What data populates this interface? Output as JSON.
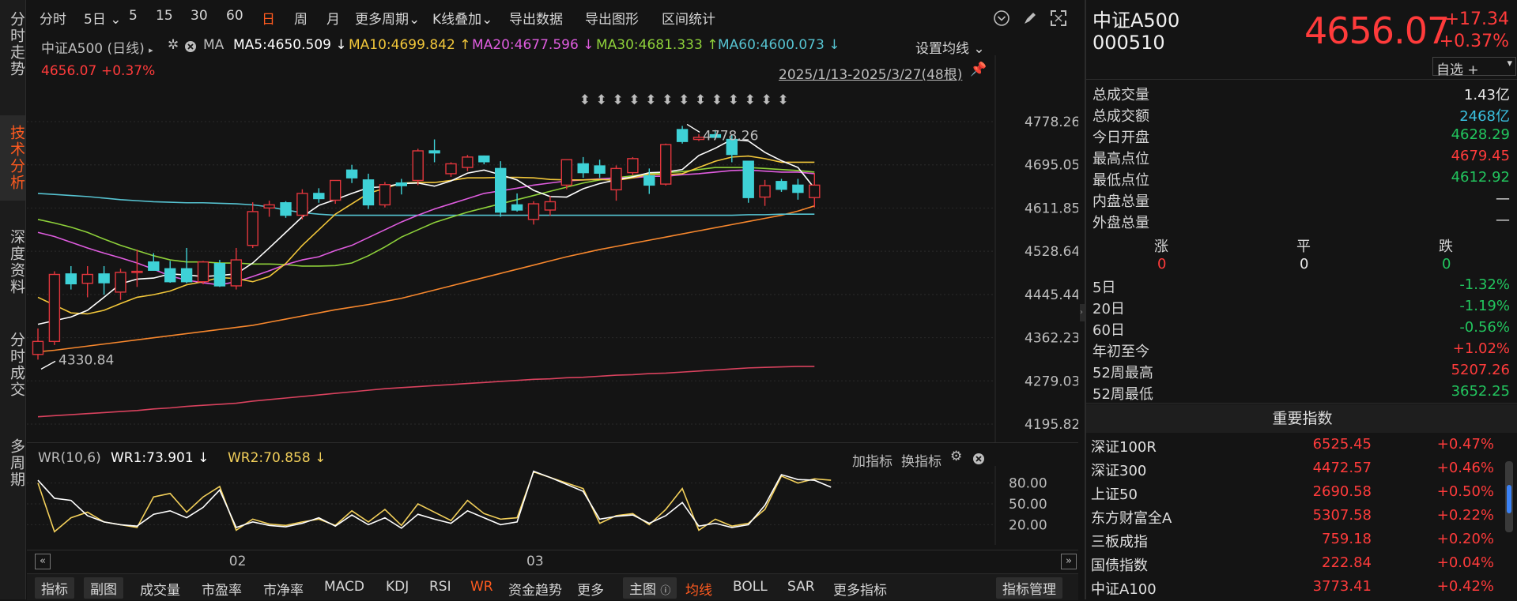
{
  "left_nav": [
    {
      "label": "分时走势",
      "active": false
    },
    {
      "label": "技术分析",
      "active": true
    },
    {
      "label": "深度资料",
      "active": false
    },
    {
      "label": "分时成交",
      "active": false
    },
    {
      "label": "多周期",
      "active": false
    }
  ],
  "toolbar": {
    "items": [
      "分时",
      "5日",
      "5",
      "15",
      "30",
      "60",
      "日",
      "周",
      "月",
      "更多周期",
      "K线叠加",
      "导出数据",
      "导出图形",
      "区间统计"
    ],
    "active": "日"
  },
  "legend": {
    "index_name": "中证A500 (日线)",
    "ma_label": "MA",
    "ma5": "MA5:4650.509",
    "ma10": "MA10:4699.842",
    "ma20": "MA20:4677.596",
    "ma30": "MA30:4681.333",
    "ma60": "MA60:4600.073",
    "settings": "设置均线",
    "price": "4656.07",
    "pct": "+0.37%",
    "range": "2025/1/13-2025/3/27(48根)"
  },
  "colors": {
    "up": "#e2363d",
    "down": "#3ed1d6",
    "ma5": "#ffffff",
    "ma10": "#f2c73a",
    "ma20": "#df5cdf",
    "ma30": "#8ed13a",
    "ma60": "#56c3d1",
    "ma120": "#f7872d",
    "ma250": "#d9425e",
    "wr1": "#ffffff",
    "wr2": "#f2cf5a"
  },
  "chart_data": {
    "type": "candlestick",
    "y_ticks": [
      "4778.26",
      "4695.05",
      "4611.85",
      "4528.64",
      "4445.44",
      "4362.23",
      "4279.03",
      "4195.82"
    ],
    "ylim": [
      4195.82,
      4778.26
    ],
    "x_ticks": [
      {
        "label": "02",
        "index": 12
      },
      {
        "label": "03",
        "index": 30
      }
    ],
    "annotations": {
      "low": "4330.84",
      "high": "4778.26"
    },
    "candles": [
      {
        "o": 4330,
        "h": 4380,
        "l": 4320,
        "c": 4355
      },
      {
        "o": 4355,
        "h": 4490,
        "l": 4348,
        "c": 4484
      },
      {
        "o": 4485,
        "h": 4500,
        "l": 4455,
        "c": 4466
      },
      {
        "o": 4467,
        "h": 4500,
        "l": 4440,
        "c": 4484
      },
      {
        "o": 4485,
        "h": 4500,
        "l": 4445,
        "c": 4468
      },
      {
        "o": 4450,
        "h": 4495,
        "l": 4435,
        "c": 4488
      },
      {
        "o": 4488,
        "h": 4532,
        "l": 4460,
        "c": 4490
      },
      {
        "o": 4508,
        "h": 4525,
        "l": 4496,
        "c": 4492
      },
      {
        "o": 4495,
        "h": 4510,
        "l": 4468,
        "c": 4470
      },
      {
        "o": 4495,
        "h": 4535,
        "l": 4467,
        "c": 4470
      },
      {
        "o": 4470,
        "h": 4510,
        "l": 4465,
        "c": 4508
      },
      {
        "o": 4505,
        "h": 4512,
        "l": 4460,
        "c": 4462
      },
      {
        "o": 4462,
        "h": 4535,
        "l": 4455,
        "c": 4512
      },
      {
        "o": 4540,
        "h": 4623,
        "l": 4535,
        "c": 4605
      },
      {
        "o": 4612,
        "h": 4626,
        "l": 4595,
        "c": 4618
      },
      {
        "o": 4622,
        "h": 4625,
        "l": 4593,
        "c": 4598
      },
      {
        "o": 4598,
        "h": 4648,
        "l": 4590,
        "c": 4640
      },
      {
        "o": 4640,
        "h": 4650,
        "l": 4622,
        "c": 4630
      },
      {
        "o": 4627,
        "h": 4665,
        "l": 4620,
        "c": 4665
      },
      {
        "o": 4685,
        "h": 4695,
        "l": 4660,
        "c": 4670
      },
      {
        "o": 4666,
        "h": 4678,
        "l": 4610,
        "c": 4618
      },
      {
        "o": 4618,
        "h": 4662,
        "l": 4613,
        "c": 4657
      },
      {
        "o": 4660,
        "h": 4668,
        "l": 4638,
        "c": 4655
      },
      {
        "o": 4665,
        "h": 4726,
        "l": 4656,
        "c": 4722
      },
      {
        "o": 4722,
        "h": 4744,
        "l": 4700,
        "c": 4718
      },
      {
        "o": 4678,
        "h": 4700,
        "l": 4672,
        "c": 4697
      },
      {
        "o": 4690,
        "h": 4714,
        "l": 4683,
        "c": 4710
      },
      {
        "o": 4712,
        "h": 4713,
        "l": 4696,
        "c": 4701
      },
      {
        "o": 4688,
        "h": 4702,
        "l": 4595,
        "c": 4604
      },
      {
        "o": 4618,
        "h": 4640,
        "l": 4605,
        "c": 4608
      },
      {
        "o": 4590,
        "h": 4625,
        "l": 4580,
        "c": 4620
      },
      {
        "o": 4608,
        "h": 4635,
        "l": 4597,
        "c": 4624
      },
      {
        "o": 4656,
        "h": 4706,
        "l": 4648,
        "c": 4705
      },
      {
        "o": 4697,
        "h": 4710,
        "l": 4670,
        "c": 4680
      },
      {
        "o": 4693,
        "h": 4705,
        "l": 4670,
        "c": 4679
      },
      {
        "o": 4647,
        "h": 4694,
        "l": 4626,
        "c": 4688
      },
      {
        "o": 4680,
        "h": 4710,
        "l": 4675,
        "c": 4707
      },
      {
        "o": 4674,
        "h": 4688,
        "l": 4639,
        "c": 4656
      },
      {
        "o": 4658,
        "h": 4736,
        "l": 4655,
        "c": 4734
      },
      {
        "o": 4763,
        "h": 4770,
        "l": 4736,
        "c": 4740
      },
      {
        "o": 4744,
        "h": 4754,
        "l": 4741,
        "c": 4748
      },
      {
        "o": 4753,
        "h": 4762,
        "l": 4744,
        "c": 4748
      },
      {
        "o": 4744,
        "h": 4752,
        "l": 4700,
        "c": 4715
      },
      {
        "o": 4702,
        "h": 4702,
        "l": 4622,
        "c": 4632
      },
      {
        "o": 4633,
        "h": 4666,
        "l": 4616,
        "c": 4655
      },
      {
        "o": 4663,
        "h": 4668,
        "l": 4643,
        "c": 4648
      },
      {
        "o": 4656,
        "h": 4668,
        "l": 4628,
        "c": 4642
      },
      {
        "o": 4632,
        "h": 4679,
        "l": 4613,
        "c": 4656
      }
    ],
    "ma_lines": {
      "ma5": [
        4388,
        4395,
        4402,
        4415,
        4440,
        4466,
        4475,
        4477,
        4485,
        4483,
        4480,
        4482,
        4485,
        4506,
        4535,
        4565,
        4595,
        4617,
        4628,
        4640,
        4651,
        4653,
        4659,
        4660,
        4654,
        4664,
        4679,
        4685,
        4676,
        4666,
        4646,
        4634,
        4633,
        4649,
        4659,
        4666,
        4672,
        4680,
        4681,
        4686,
        4713,
        4727,
        4744,
        4741,
        4719,
        4703,
        4690,
        4650
      ],
      "ma10": [
        4440,
        4425,
        4410,
        4408,
        4415,
        4428,
        4440,
        4445,
        4452,
        4464,
        4470,
        4478,
        4476,
        4470,
        4480,
        4505,
        4540,
        4570,
        4600,
        4620,
        4640,
        4650,
        4660,
        4661,
        4661,
        4665,
        4670,
        4670,
        4671,
        4671,
        4670,
        4667,
        4666,
        4666,
        4667,
        4665,
        4670,
        4677,
        4676,
        4678,
        4690,
        4702,
        4710,
        4712,
        4707,
        4700,
        4700,
        4700
      ],
      "ma20": [
        4565,
        4557,
        4546,
        4535,
        4525,
        4516,
        4506,
        4494,
        4481,
        4473,
        4468,
        4464,
        4470,
        4480,
        4491,
        4503,
        4512,
        4518,
        4530,
        4540,
        4555,
        4570,
        4585,
        4598,
        4610,
        4620,
        4630,
        4640,
        4645,
        4650,
        4656,
        4660,
        4664,
        4666,
        4668,
        4670,
        4670,
        4673,
        4673,
        4676,
        4678,
        4681,
        4684,
        4685,
        4683,
        4681,
        4681,
        4678
      ],
      "ma30": [
        4590,
        4583,
        4575,
        4565,
        4552,
        4540,
        4530,
        4520,
        4512,
        4508,
        4508,
        4506,
        4506,
        4504,
        4504,
        4503,
        4500,
        4500,
        4501,
        4506,
        4520,
        4537,
        4556,
        4570,
        4584,
        4594,
        4604,
        4612,
        4620,
        4628,
        4636,
        4644,
        4652,
        4660,
        4666,
        4670,
        4674,
        4678,
        4680,
        4682,
        4686,
        4690,
        4690,
        4690,
        4688,
        4686,
        4684,
        4681
      ],
      "ma60": [
        4640,
        4638,
        4636,
        4634,
        4631,
        4628,
        4626,
        4624,
        4623,
        4622,
        4622,
        4621,
        4620,
        4618,
        4614,
        4608,
        4603,
        4600,
        4598,
        4598,
        4598,
        4598,
        4598,
        4598,
        4598,
        4598,
        4598,
        4598,
        4598,
        4598,
        4598,
        4598,
        4598,
        4598,
        4598,
        4598,
        4598,
        4598,
        4598,
        4598,
        4598,
        4598,
        4598,
        4599,
        4599,
        4600,
        4600,
        4600
      ],
      "ma120": [
        4335,
        4338,
        4342,
        4346,
        4350,
        4354,
        4358,
        4362,
        4366,
        4370,
        4374,
        4378,
        4382,
        4386,
        4392,
        4398,
        4404,
        4410,
        4416,
        4421,
        4426,
        4432,
        4438,
        4446,
        4454,
        4462,
        4470,
        4478,
        4486,
        4494,
        4502,
        4510,
        4518,
        4525,
        4532,
        4538,
        4544,
        4550,
        4556,
        4562,
        4568,
        4574,
        4580,
        4586,
        4592,
        4598,
        4606,
        4616
      ],
      "ma250": [
        4210,
        4212,
        4214,
        4216,
        4218,
        4220,
        4222,
        4225,
        4227,
        4230,
        4232,
        4234,
        4236,
        4240,
        4243,
        4246,
        4249,
        4252,
        4255,
        4258,
        4261,
        4264,
        4266,
        4268,
        4270,
        4272,
        4274,
        4276,
        4278,
        4280,
        4282,
        4283,
        4285,
        4286,
        4288,
        4290,
        4291,
        4293,
        4294,
        4296,
        4298,
        4300,
        4302,
        4304,
        4305,
        4306,
        4307,
        4307
      ]
    },
    "wr": {
      "label": "WR(10,6)",
      "wr1_label": "WR1:73.901",
      "wr2_label": "WR2:70.858",
      "ylim": [
        0,
        100
      ],
      "y_ticks": [
        "80.00",
        "50.00",
        "20.00"
      ],
      "wr1": [
        84,
        58,
        55,
        33,
        24,
        20,
        18,
        35,
        40,
        30,
        45,
        70,
        16,
        24,
        19,
        17,
        22,
        30,
        18,
        34,
        20,
        30,
        15,
        35,
        28,
        22,
        40,
        30,
        20,
        24,
        97,
        88,
        78,
        68,
        28,
        32,
        34,
        22,
        33,
        52,
        18,
        22,
        16,
        20,
        48,
        92,
        85,
        84,
        74
      ],
      "wr2": [
        80,
        10,
        30,
        38,
        24,
        20,
        16,
        60,
        65,
        38,
        60,
        75,
        12,
        28,
        21,
        19,
        24,
        28,
        19,
        40,
        24,
        42,
        19,
        50,
        38,
        26,
        55,
        36,
        28,
        30,
        96,
        88,
        80,
        72,
        22,
        33,
        36,
        20,
        42,
        72,
        12,
        28,
        18,
        22,
        42,
        90,
        80,
        86,
        84
      ]
    }
  },
  "wr_panel": {
    "add_indicator": "加指标",
    "switch_indicator": "换指标"
  },
  "bottombar": {
    "items": [
      "指标",
      "副图",
      "成交量",
      "市盈率",
      "市净率",
      "MACD",
      "KDJ",
      "RSI",
      "WR",
      "资金趋势",
      "更多",
      "主图",
      "均线",
      "BOLL",
      "SAR",
      "更多指标",
      "指标管理"
    ],
    "active": [
      "WR",
      "均线"
    ]
  },
  "quote": {
    "name": "中证A500",
    "code": "000510",
    "price": "4656.07",
    "change": "+17.34",
    "pct": "+0.37%",
    "watch": "自选 +"
  },
  "stats": [
    {
      "k": "总成交量",
      "v": "1.43亿",
      "c": "white"
    },
    {
      "k": "总成交额",
      "v": "2468亿",
      "c": "cyan"
    },
    {
      "k": "今日开盘",
      "v": "4628.29",
      "c": "green"
    },
    {
      "k": "最高点位",
      "v": "4679.45",
      "c": "red"
    },
    {
      "k": "最低点位",
      "v": "4612.92",
      "c": "green"
    },
    {
      "k": "内盘总量",
      "v": "—",
      "c": "white"
    },
    {
      "k": "外盘总量",
      "v": "—",
      "c": "white"
    }
  ],
  "breadth": {
    "up_label": "涨",
    "flat_label": "平",
    "down_label": "跌",
    "up": "0",
    "flat": "0",
    "down": "0"
  },
  "periods": [
    {
      "k": "5日",
      "v": "-1.32%",
      "c": "green"
    },
    {
      "k": "20日",
      "v": "-1.19%",
      "c": "green"
    },
    {
      "k": "60日",
      "v": "-0.56%",
      "c": "green"
    },
    {
      "k": "年初至今",
      "v": "+1.02%",
      "c": "red"
    },
    {
      "k": "52周最高",
      "v": "5207.26",
      "c": "red"
    },
    {
      "k": "52周最低",
      "v": "3652.25",
      "c": "green"
    }
  ],
  "important_title": "重要指数",
  "indices": [
    {
      "n": "深证100R",
      "p": "6525.45",
      "c": "+0.47%"
    },
    {
      "n": "深证300",
      "p": "4472.57",
      "c": "+0.46%"
    },
    {
      "n": "上证50",
      "p": "2690.58",
      "c": "+0.50%"
    },
    {
      "n": "东方财富全A",
      "p": "5307.58",
      "c": "+0.22%"
    },
    {
      "n": "三板成指",
      "p": "759.18",
      "c": "+0.20%"
    },
    {
      "n": "国债指数",
      "p": "222.84",
      "c": "+0.04%"
    },
    {
      "n": "中证A100",
      "p": "3773.41",
      "c": "+0.42%"
    }
  ]
}
